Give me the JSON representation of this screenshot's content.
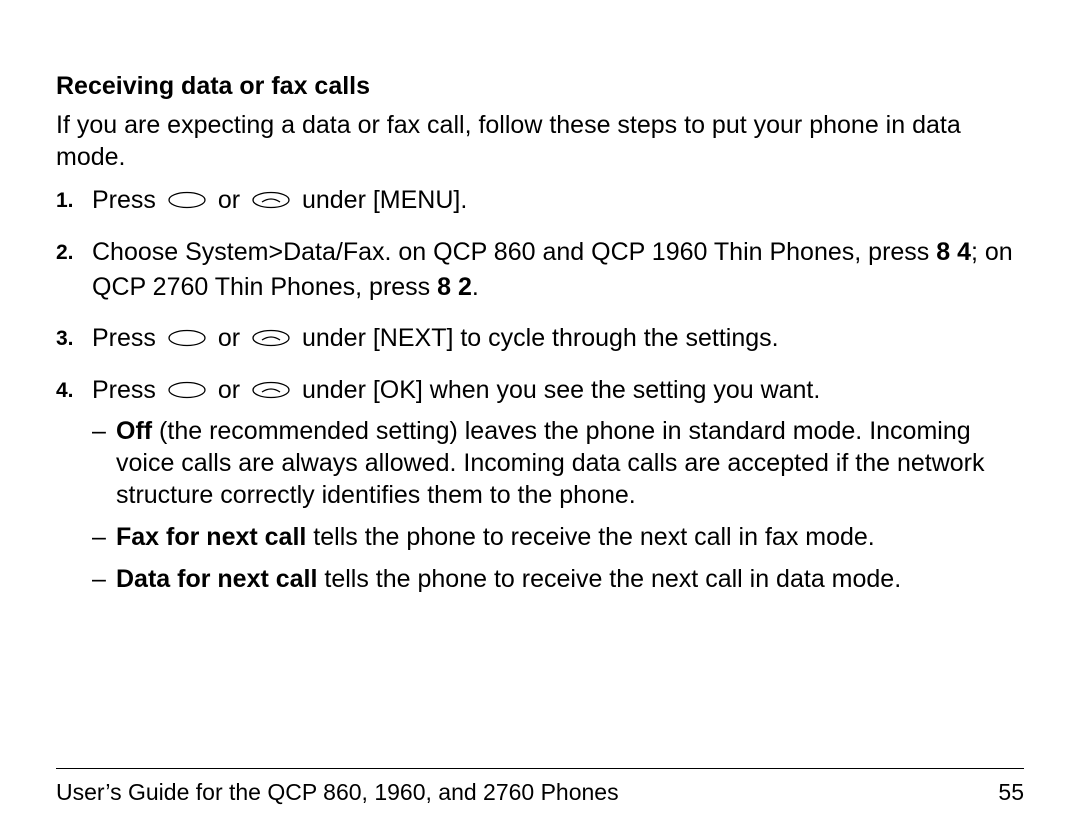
{
  "heading": "Receiving data or fax calls",
  "intro": "If you are expecting a data or fax call, follow these steps to put your phone in data mode.",
  "steps": {
    "s1": {
      "num": "1.",
      "a": "Press ",
      "b": " or ",
      "c": " under [MENU]."
    },
    "s2": {
      "num": "2.",
      "a": "Choose System>Data/Fax. on QCP 860 and QCP 1960 Thin Phones, press ",
      "bold1": "8 4",
      "b": "; on QCP 2760 Thin Phones, press ",
      "bold2": "8 2",
      "c": "."
    },
    "s3": {
      "num": "3.",
      "a": "Press ",
      "b": " or ",
      "c": " under [NEXT] to cycle through the settings."
    },
    "s4": {
      "num": "4.",
      "a": "Press ",
      "b": " or ",
      "c": " under [OK] when you see the setting you want.",
      "sub": {
        "i1": {
          "dash": "–",
          "bold": "Off",
          "rest": " (the recommended setting) leaves the phone in standard mode. Incoming voice calls are always allowed. Incoming data calls are accepted if the network structure correctly identifies them to the phone."
        },
        "i2": {
          "dash": "–",
          "bold": "Fax for next call",
          "rest": " tells the phone to receive the next call in fax mode."
        },
        "i3": {
          "dash": "–",
          "bold": "Data for next call",
          "rest": " tells the phone to receive the next call in data mode."
        }
      }
    }
  },
  "footer": {
    "title": "User’s Guide for the QCP 860, 1960, and 2760 Phones",
    "page": "55"
  }
}
